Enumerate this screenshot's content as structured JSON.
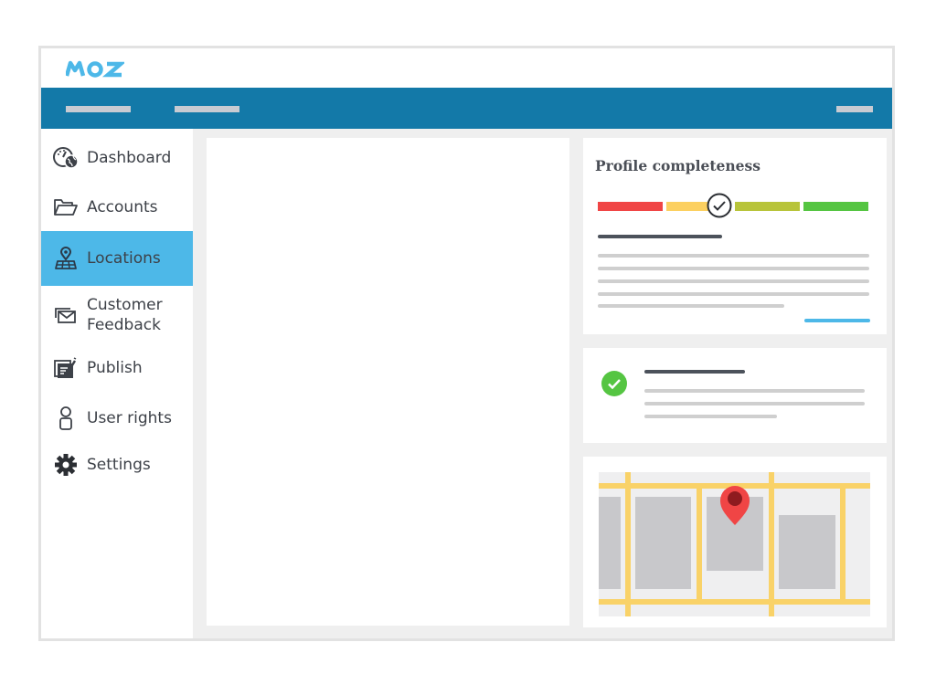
{
  "app": {
    "logo_text": "MOZ",
    "brand_color": "#4db8e8",
    "navbar_color": "#1379a8"
  },
  "sidebar": {
    "items": [
      {
        "label": "Dashboard",
        "icon": "dashboard-icon",
        "active": false
      },
      {
        "label": "Accounts",
        "icon": "folder-icon",
        "active": false
      },
      {
        "label": "Locations",
        "icon": "location-map-icon",
        "active": true
      },
      {
        "label": "Customer Feedback",
        "icon": "envelope-icon",
        "active": false
      },
      {
        "label": "Publish",
        "icon": "publish-icon",
        "active": false
      },
      {
        "label": "User rights",
        "icon": "user-icon",
        "active": false
      },
      {
        "label": "Settings",
        "icon": "gear-icon",
        "active": false
      }
    ]
  },
  "profile_card": {
    "title": "Profile completeness",
    "progress_segments": [
      {
        "color": "#f04545"
      },
      {
        "color": "#fcd060"
      },
      {
        "color": "#b8c43a"
      },
      {
        "color": "#55c542"
      }
    ],
    "progress_marker_fraction": 0.45,
    "marker_icon": "check-circle-icon"
  },
  "status_card": {
    "icon": "check-circle-icon",
    "icon_color": "#55c542"
  },
  "map_card": {
    "pin_color": "#f04545",
    "road_color": "#f9d268",
    "block_color": "#c8c8cb"
  }
}
